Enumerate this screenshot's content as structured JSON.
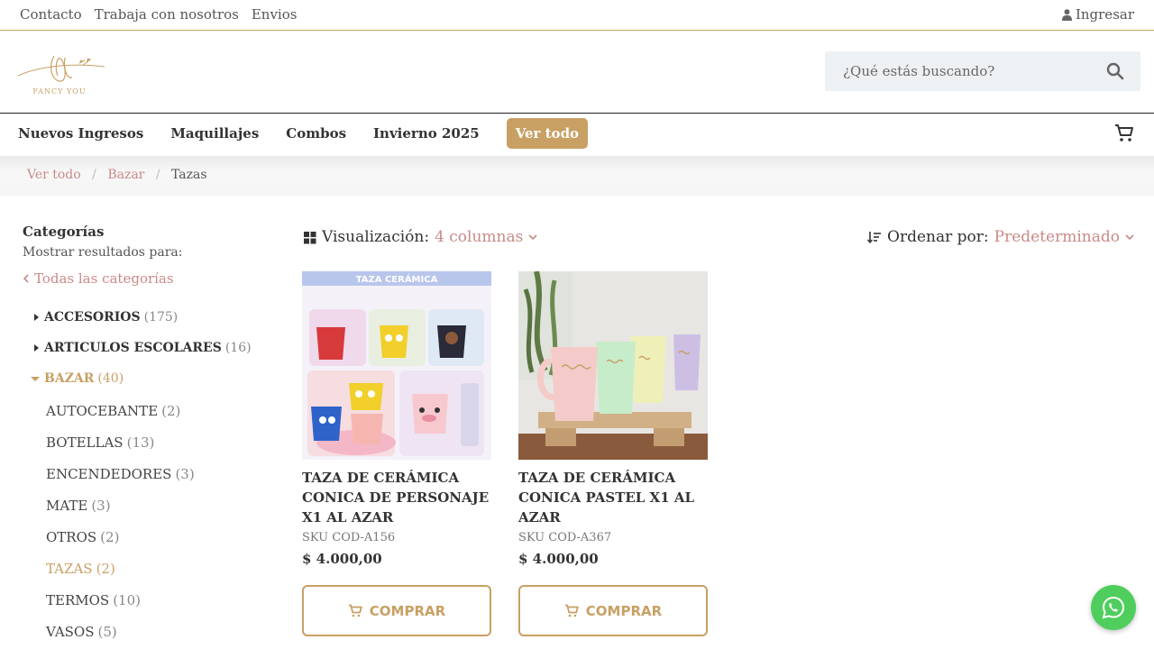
{
  "topbar": {
    "links": [
      "Contacto",
      "Trabaja con nosotros",
      "Envios"
    ],
    "login_label": "Ingresar"
  },
  "header": {
    "logo_text": "FANCY YOU",
    "search_placeholder": "¿Qué estás buscando?"
  },
  "nav": {
    "items": [
      "Nuevos Ingresos",
      "Maquillajes",
      "Combos",
      "Invierno 2025"
    ],
    "highlight": "Ver todo"
  },
  "breadcrumb": {
    "items": [
      "Ver todo",
      "Bazar",
      "Tazas"
    ]
  },
  "sidebar": {
    "title": "Categorías",
    "subtitle": "Mostrar resultados para:",
    "all_link": "Todas las categorías",
    "categories": [
      {
        "name": "ACCESORIOS",
        "count": "(175)"
      },
      {
        "name": "ARTICULOS ESCOLARES",
        "count": "(16)"
      },
      {
        "name": "BAZAR",
        "count": "(40)"
      }
    ],
    "subcategories": [
      {
        "name": "AUTOCEBANTE",
        "count": "(2)"
      },
      {
        "name": "BOTELLAS",
        "count": "(13)"
      },
      {
        "name": "ENCENDEDORES",
        "count": "(3)"
      },
      {
        "name": "MATE",
        "count": "(3)"
      },
      {
        "name": "OTROS",
        "count": "(2)"
      },
      {
        "name": "TAZAS",
        "count": "(2)"
      },
      {
        "name": "TERMOS",
        "count": "(10)"
      },
      {
        "name": "VASOS",
        "count": "(5)"
      }
    ]
  },
  "toolbar": {
    "viz_label": "Visualización:",
    "viz_value": "4 columnas",
    "order_label": "Ordenar por:",
    "order_value": "Predeterminado"
  },
  "products": [
    {
      "badge": "TAZA CERÁMICA",
      "name": "TAZA DE CERÁMICA CONICA DE PERSONAJE X1 AL AZAR",
      "sku": "SKU COD-A156",
      "price": "$  4.000,00",
      "buy": "COMPRAR"
    },
    {
      "name": "TAZA DE CERÁMICA CONICA PASTEL X1 AL AZAR",
      "sku": "SKU COD-A367",
      "price": "$  4.000,00",
      "buy": "COMPRAR"
    }
  ],
  "colors": {
    "accent": "#c8a064",
    "link": "#c98a86",
    "whatsapp": "#4fce5d"
  }
}
